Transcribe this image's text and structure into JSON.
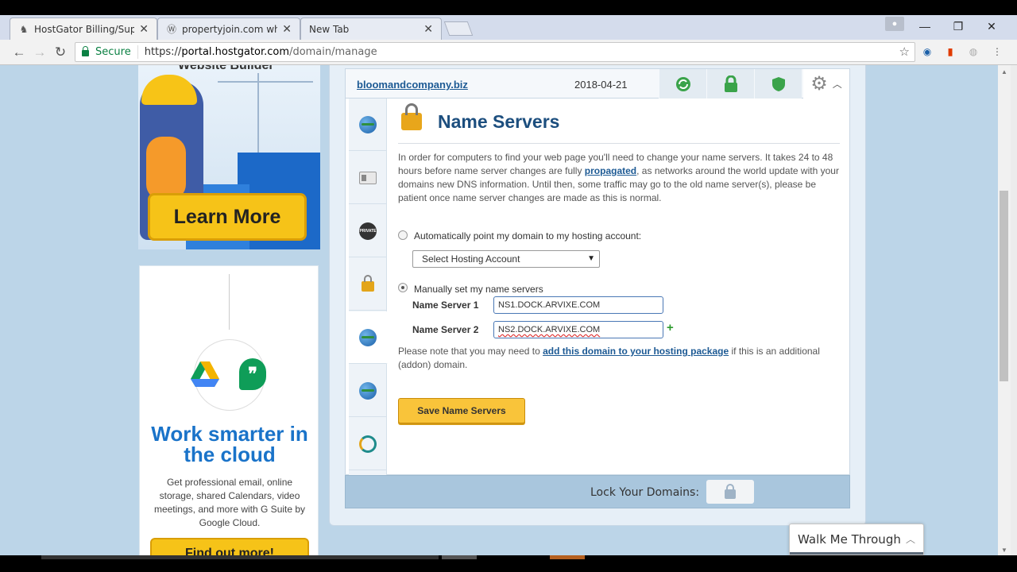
{
  "browser": {
    "tabs": [
      {
        "title": "HostGator Billing/Suppo",
        "favicon": "gator-icon",
        "active": true
      },
      {
        "title": "propertyjoin.com whois |",
        "favicon": "wordpress-icon",
        "active": false
      },
      {
        "title": "New Tab",
        "favicon": "",
        "active": false
      }
    ],
    "secure_label": "Secure",
    "url_scheme": "https://",
    "url_host": "portal.hostgator.com",
    "url_path": "/domain/manage"
  },
  "ad_top": {
    "caption": "Website Builder",
    "cta": "Learn More"
  },
  "ad_gsuite": {
    "headline": "Work smarter in the cloud",
    "body": "Get professional email, online storage, shared Calendars, video meetings, and more with G Suite by Google Cloud.",
    "cta": "Find out more!"
  },
  "domain": {
    "name": "bloomandcompany.biz",
    "date": "2018-04-21"
  },
  "nameservers": {
    "title": "Name Servers",
    "intro_before": "In order for computers to find your web page you'll need to change your name servers. It takes 24 to 48 hours before name server changes are fully ",
    "intro_link": "propagated",
    "intro_after": ", as networks around the world update with your domains new DNS information. Until then, some traffic may go to the old name server(s), please be patient once name server changes are made as this is normal.",
    "auto_label": "Automatically point my domain to my hosting account:",
    "hosting_select": "Select Hosting Account",
    "manual_label": "Manually set my name servers",
    "ns1_label": "Name Server 1",
    "ns1_value": "NS1.DOCK.ARVIXE.COM",
    "ns2_label": "Name Server 2",
    "ns2_value": "NS2.DOCK.ARVIXE.COM",
    "note_before": "Please note that you may need to ",
    "note_link": "add this domain to your hosting package",
    "note_after": " if this is an additional (addon) domain.",
    "save_label": "Save Name Servers"
  },
  "lockbar": {
    "label": "Lock Your Domains:"
  },
  "walkme": {
    "label": "Walk Me Through"
  },
  "colors": {
    "page_bg": "#bcd5e8",
    "brand_blue": "#1c4e7e",
    "button_yellow": "#f9c43a"
  }
}
